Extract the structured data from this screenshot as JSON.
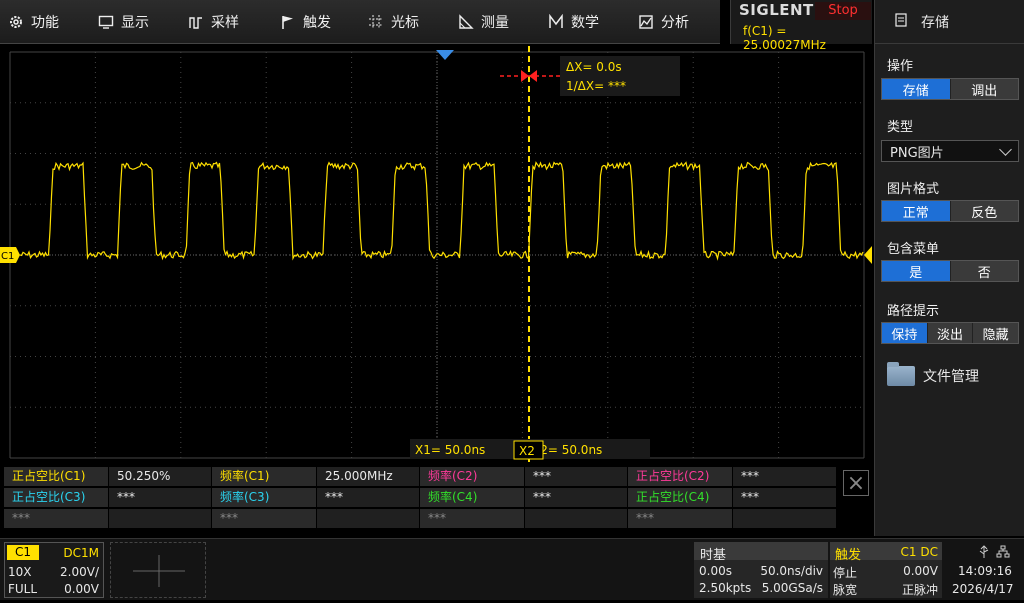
{
  "menu": [
    {
      "label": "功能",
      "icon": "gear-icon"
    },
    {
      "label": "显示",
      "icon": "monitor-icon"
    },
    {
      "label": "采样",
      "icon": "sample-icon"
    },
    {
      "label": "触发",
      "icon": "flag-icon"
    },
    {
      "label": "光标",
      "icon": "cursor-icon"
    },
    {
      "label": "测量",
      "icon": "ruler-icon"
    },
    {
      "label": "数学",
      "icon": "math-icon"
    },
    {
      "label": "分析",
      "icon": "analysis-icon"
    }
  ],
  "brand": {
    "name": "SIGLENT",
    "status": "Stop",
    "freq": "f(C1) = 25.00027MHz"
  },
  "panel": {
    "title": "存储",
    "op_label": "操作",
    "op_options": [
      "存储",
      "调出"
    ],
    "type_label": "类型",
    "type_value": "PNG图片",
    "fmt_label": "图片格式",
    "fmt_options": [
      "正常",
      "反色"
    ],
    "menu_label": "包含菜单",
    "menu_options": [
      "是",
      "否"
    ],
    "path_label": "路径提示",
    "path_options": [
      "保持",
      "淡出",
      "隐藏"
    ],
    "filemgr": "文件管理"
  },
  "cursor": {
    "dx": "ΔX= 0.0s",
    "inv_dx": "1/ΔX= ***",
    "x1": "X1= 50.0ns",
    "x2_tag": "X2",
    "x2": "X2= 50.0ns"
  },
  "channel_marker": "C1",
  "measurements": [
    [
      {
        "label": "正占空比(C1)",
        "value": "50.250%",
        "color": "#ffe000"
      },
      {
        "label": "频率(C1)",
        "value": "25.000MHz",
        "color": "#ffe000"
      },
      {
        "label": "频率(C2)",
        "value": "***",
        "color": "#ff3a9a"
      },
      {
        "label": "正占空比(C2)",
        "value": "***",
        "color": "#ff3a9a"
      }
    ],
    [
      {
        "label": "正占空比(C3)",
        "value": "***",
        "color": "#2ad4f0"
      },
      {
        "label": "频率(C3)",
        "value": "***",
        "color": "#2ad4f0"
      },
      {
        "label": "频率(C4)",
        "value": "***",
        "color": "#32e02a"
      },
      {
        "label": "正占空比(C4)",
        "value": "***",
        "color": "#32e02a"
      }
    ],
    [
      {
        "label": "***",
        "value": "",
        "color": "#888"
      },
      {
        "label": "***",
        "value": "",
        "color": "#888"
      },
      {
        "label": "***",
        "value": "",
        "color": "#888"
      },
      {
        "label": "***",
        "value": "",
        "color": "#888"
      }
    ]
  ],
  "ch1": {
    "tag": "C1",
    "coupling": "DC1M",
    "probe": "10X",
    "scale": "2.00V/",
    "bw": "FULL",
    "offset": "0.00V"
  },
  "timebase": {
    "title": "时基",
    "delay": "0.00s",
    "scale": "50.0ns/div",
    "points": "2.50kpts",
    "rate": "5.00GSa/s"
  },
  "trigger": {
    "title": "触发",
    "source": "C1 DC",
    "state": "停止",
    "level": "0.00V",
    "type": "脉宽",
    "polarity": "正脉冲"
  },
  "clock": {
    "time": "14:09:16",
    "date": "2026/4/17"
  },
  "colors": {
    "ch1": "#ffe000",
    "accent": "#1e6fd6",
    "stop": "#ff3030",
    "cursor": "#ffe000"
  }
}
